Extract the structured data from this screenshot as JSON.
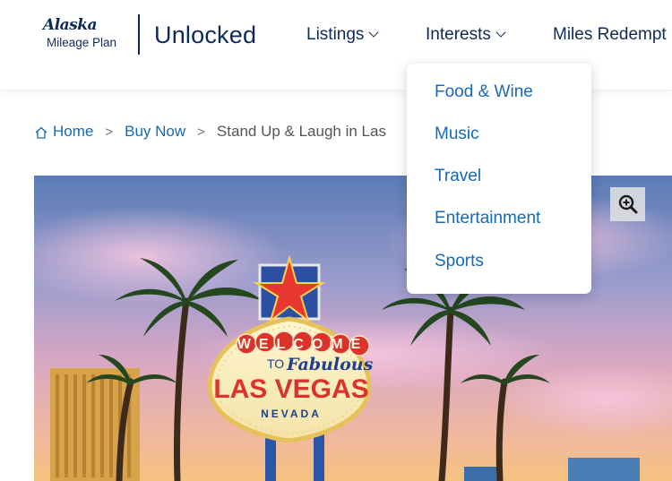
{
  "header": {
    "logo_script": "Alaska",
    "logo_sub": "Mileage Plan",
    "brand": "Unlocked",
    "nav": [
      {
        "label": "Listings"
      },
      {
        "label": "Interests"
      },
      {
        "label": "Miles Redempt"
      }
    ]
  },
  "dropdown": {
    "items": [
      {
        "label": "Food & Wine"
      },
      {
        "label": "Music"
      },
      {
        "label": "Travel"
      },
      {
        "label": "Entertainment"
      },
      {
        "label": "Sports"
      }
    ]
  },
  "breadcrumb": {
    "home": "Home",
    "buy_now": "Buy Now",
    "current": "Stand Up & Laugh in Las",
    "separator": ">"
  },
  "hero": {
    "sign_welcome": "WELCOME",
    "sign_to": "TO",
    "sign_fabulous": "Fabulous",
    "sign_city": "LAS VEGAS",
    "sign_state": "NEVADA"
  },
  "colors": {
    "brand_navy": "#0e2b57",
    "link_blue": "#1469b8"
  },
  "icons": {
    "home": "home-icon",
    "zoom": "zoom-in-icon",
    "chevron": "chevron-down-icon"
  }
}
